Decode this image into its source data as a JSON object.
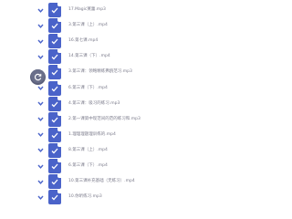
{
  "colors": {
    "accent": "#4a63c9",
    "text": "#7a7a8a"
  },
  "files": [
    {
      "name": "17.Magic寞蕾.mp3"
    },
    {
      "name": "3.第三课（上）.mp4"
    },
    {
      "name": "16.第七课.mp4"
    },
    {
      "name": "14.第三课（下）.mp4"
    },
    {
      "name": "3.第三课：领略精练弗鸥范习.mp3"
    },
    {
      "name": "6.第三课（下）.mp4"
    },
    {
      "name": "4.第三课：吸习的练习.mp3"
    },
    {
      "name": "2.第一课第中现范间的范的练习和.mp3"
    },
    {
      "name": "1.理理理题理训练的.mp4"
    },
    {
      "name": "8.第三课（上）.mp4"
    },
    {
      "name": "6.第三课（下）.mp4"
    },
    {
      "name": "10.第三课补充基础（无练习）.mp4"
    },
    {
      "name": "10.你听练习.mp3"
    }
  ]
}
